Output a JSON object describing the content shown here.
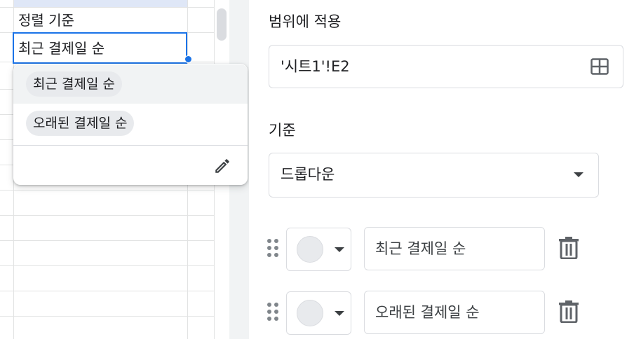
{
  "sheet": {
    "header_cell_text": "정렬 기준",
    "active_cell_value": "최근 결제일 순"
  },
  "dropdown_popup": {
    "options": [
      {
        "label": "최근 결제일 순",
        "highlighted": true
      },
      {
        "label": "오래된 결제일 순",
        "highlighted": false
      }
    ],
    "edit_icon": "pencil-icon"
  },
  "panel": {
    "range_label": "범위에 적용",
    "range_value": "'시트1'!E2",
    "range_icon": "grid-select-icon",
    "criteria_label": "기준",
    "criteria_value": "드롭다운",
    "items": [
      {
        "value": "최근 결제일 순",
        "color": "#e8eaed"
      },
      {
        "value": "오래된 결제일 순",
        "color": "#e8eaed"
      }
    ]
  },
  "colors": {
    "accent": "#1a73e8",
    "chip": "#e8eaed",
    "border": "#dadce0"
  }
}
